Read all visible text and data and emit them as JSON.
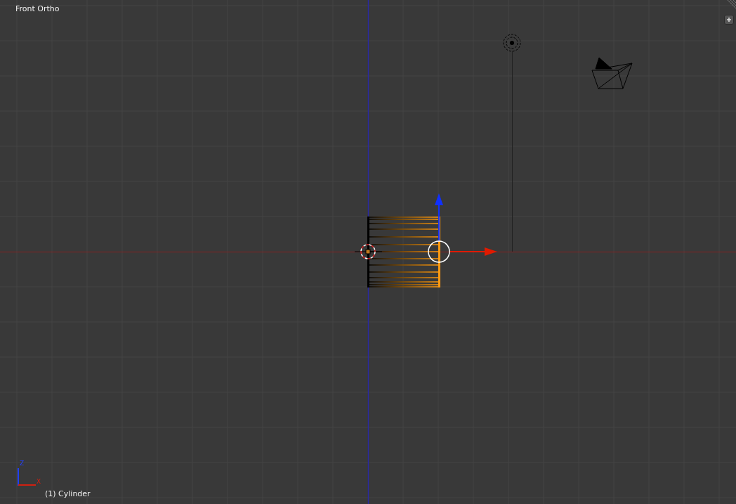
{
  "viewport": {
    "view_name": "Front Ortho",
    "object_label": "(1) Cylinder",
    "axis_labels": {
      "z": "Z",
      "x": "X"
    }
  }
}
